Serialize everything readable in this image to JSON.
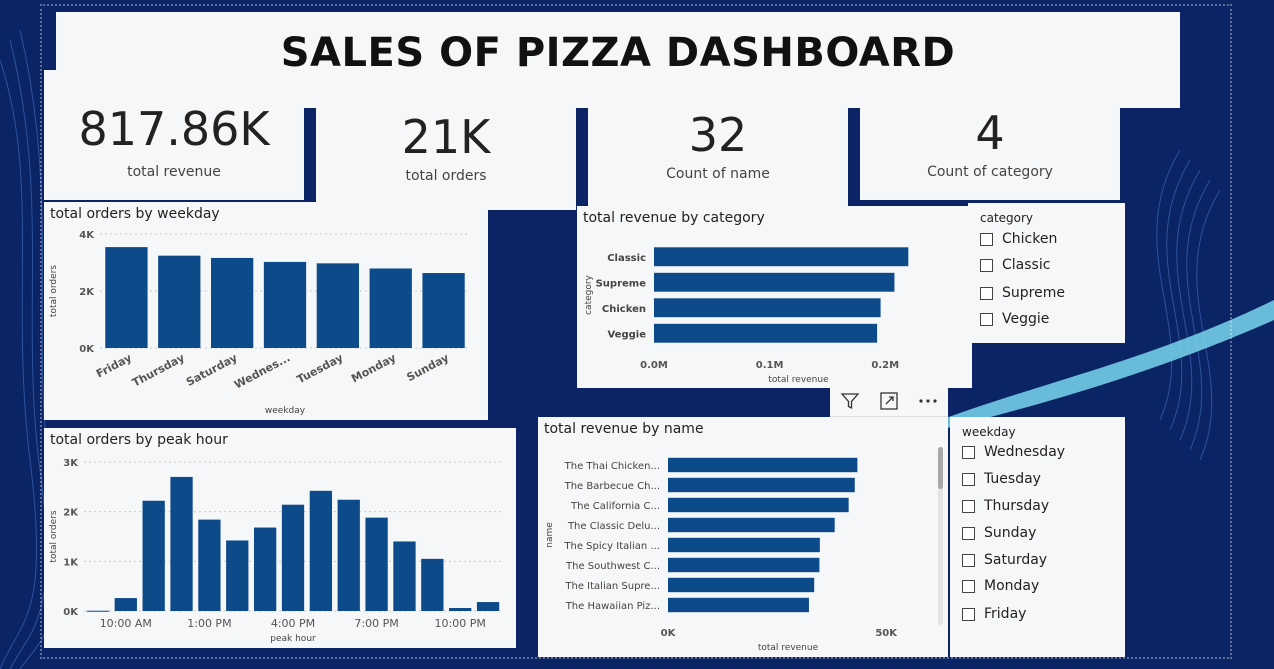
{
  "dashboard": {
    "title": "SALES OF PIZZA DASHBOARD"
  },
  "kpis": [
    {
      "value": "817.86K",
      "label": "total revenue"
    },
    {
      "value": "21K",
      "label": "total orders"
    },
    {
      "value": "32",
      "label": "Count of name"
    },
    {
      "value": "4",
      "label": "Count of category"
    }
  ],
  "slicers": {
    "category": {
      "title": "category",
      "items": [
        "Chicken",
        "Classic",
        "Supreme",
        "Veggie"
      ]
    },
    "weekday": {
      "title": "weekday",
      "items": [
        "Wednesday",
        "Tuesday",
        "Thursday",
        "Sunday",
        "Saturday",
        "Monday",
        "Friday"
      ]
    }
  },
  "toolbar": {
    "icons": [
      "filter-icon",
      "focus-mode-icon",
      "more-options-icon"
    ]
  },
  "colors": {
    "bar": "#0d4a8a",
    "background": "#0b2466",
    "panel": "#f6f7f9"
  },
  "chart_data": [
    {
      "id": "weekday",
      "type": "bar",
      "title": "total orders by weekday",
      "xlabel": "weekday",
      "ylabel": "total orders",
      "categories": [
        "Friday",
        "Thursday",
        "Saturday",
        "Wednes...",
        "Tuesday",
        "Monday",
        "Sunday"
      ],
      "values": [
        3540,
        3240,
        3160,
        3020,
        2970,
        2790,
        2630
      ],
      "ylim": [
        0,
        4000
      ],
      "yticks": [
        0,
        2000,
        4000
      ],
      "ytick_labels": [
        "0K",
        "2K",
        "4K"
      ],
      "grid": true
    },
    {
      "id": "category",
      "type": "bar",
      "orientation": "horizontal",
      "title": "total revenue by category",
      "xlabel": "total revenue",
      "ylabel": "category",
      "categories": [
        "Classic",
        "Supreme",
        "Chicken",
        "Veggie"
      ],
      "values": [
        220000,
        208000,
        196000,
        193000
      ],
      "xlim": [
        0,
        250000
      ],
      "xticks": [
        0,
        100000,
        200000
      ],
      "xtick_labels": [
        "0.0M",
        "0.1M",
        "0.2M"
      ],
      "grid": false
    },
    {
      "id": "peak_hour",
      "type": "bar",
      "title": "total orders by peak hour",
      "xlabel": "peak hour",
      "ylabel": "total orders",
      "x": [
        9,
        10,
        11,
        12,
        13,
        14,
        15,
        16,
        17,
        18,
        19,
        20,
        21,
        22,
        23
      ],
      "values": [
        5,
        260,
        2220,
        2700,
        1840,
        1420,
        1680,
        2140,
        2420,
        2240,
        1880,
        1400,
        1050,
        60,
        180
      ],
      "ylim": [
        0,
        3000
      ],
      "yticks": [
        0,
        1000,
        2000,
        3000
      ],
      "ytick_labels": [
        "0K",
        "1K",
        "2K",
        "3K"
      ],
      "xtick_labels": [
        {
          "x": 10,
          "label": "10:00 AM"
        },
        {
          "x": 13,
          "label": "1:00 PM"
        },
        {
          "x": 16,
          "label": "4:00 PM"
        },
        {
          "x": 19,
          "label": "7:00 PM"
        },
        {
          "x": 22,
          "label": "10:00 PM"
        }
      ],
      "grid": true
    },
    {
      "id": "name",
      "type": "bar",
      "orientation": "horizontal",
      "title": "total revenue by name",
      "xlabel": "total revenue",
      "ylabel": "name",
      "categories": [
        "The Thai Chicken...",
        "The Barbecue Ch...",
        "The California C...",
        "The Classic Delu...",
        "The Spicy Italian ...",
        "The Southwest C...",
        "The Italian Supre...",
        "The Hawaiian Piz..."
      ],
      "values": [
        43400,
        42800,
        41400,
        38200,
        34800,
        34700,
        33500,
        32300
      ],
      "xlim": [
        0,
        55000
      ],
      "xticks": [
        0,
        50000
      ],
      "xtick_labels": [
        "0K",
        "50K"
      ],
      "grid": false
    }
  ]
}
